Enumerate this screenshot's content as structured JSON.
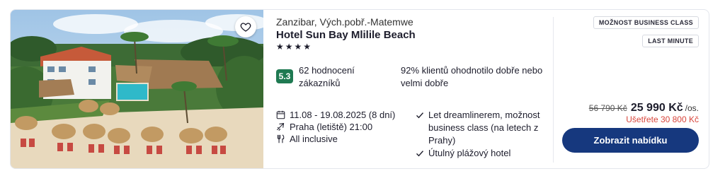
{
  "hotel": {
    "region": "Zanzibar, Vých.pobř.-Matemwe",
    "name": "Hotel Sun Bay Mlilile Beach",
    "stars": "★★★★",
    "rating": {
      "score": "5.3",
      "count_text": "62 hodnocení zákazníků",
      "summary_text": "92% klientů ohodnotilo dobře nebo velmi dobře"
    },
    "facts": [
      {
        "icon": "calendar-icon",
        "text": "11.08 - 19.08.2025 (8 dní)"
      },
      {
        "icon": "plane-icon",
        "text": "Praha (letiště) 21:00"
      },
      {
        "icon": "cutlery-icon",
        "text": "All inclusive"
      }
    ],
    "features": [
      {
        "icon": "check-icon",
        "text": "Let dreamlinerem, možnost business class (na letech z Prahy)"
      },
      {
        "icon": "check-icon",
        "text": "Útulný plážový hotel"
      }
    ]
  },
  "tags": {
    "business": "MOŽNOST BUSINESS CLASS",
    "last_minute": "LAST MINUTE"
  },
  "price": {
    "old": "56 790 Kč",
    "new": "25 990 Kč",
    "per": "/os.",
    "savings": "Ušetřete 30 800 Kč"
  },
  "cta": {
    "label": "Zobrazit nabídku"
  },
  "colors": {
    "rating_badge": "#1f7a52",
    "cta_bg": "#16387e",
    "savings": "#d8453b"
  }
}
